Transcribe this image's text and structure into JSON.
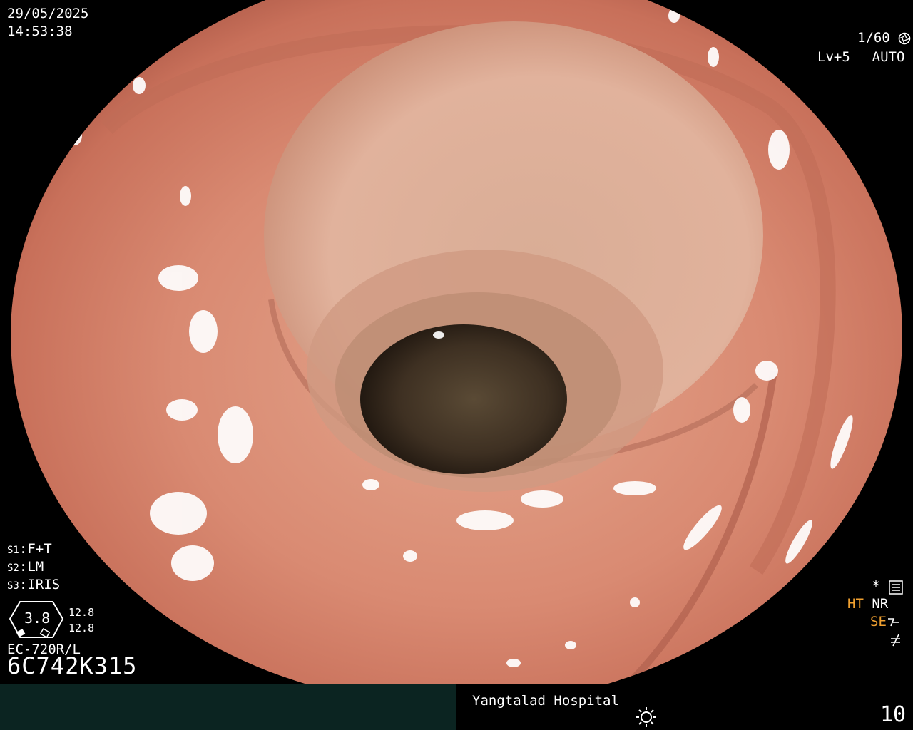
{
  "datetime": {
    "date": "29/05/2025",
    "time": "14:53:38"
  },
  "camera": {
    "shutter": "1/60",
    "level": "Lv+5",
    "mode": "AUTO"
  },
  "settings": {
    "s1": {
      "key": "S1",
      "value": "F+T"
    },
    "s2": {
      "key": "S2",
      "value": "LM"
    },
    "s3": {
      "key": "S3",
      "value": "IRIS"
    }
  },
  "scope": {
    "gauge_value": "3.8",
    "gauge_upper": "12.8",
    "gauge_lower": "12.8",
    "model": "EC-720R/L",
    "serial": "6C742K315"
  },
  "modes": {
    "ht": "HT",
    "nr": "NR",
    "se": "SE"
  },
  "footer": {
    "hospital": "Yangtalad Hospital",
    "counter": "10"
  },
  "colors": {
    "mucosa": "#d98a72",
    "lumen": "#3a2a1e",
    "footer_bar": "#0b2421",
    "mode_accent": "#f0a030"
  },
  "icons": [
    "shutter-icon",
    "auto-iris-icon",
    "menu-icon",
    "asterisk-icon",
    "structure-enhance-icon",
    "no-flash-icon",
    "light-icon"
  ]
}
